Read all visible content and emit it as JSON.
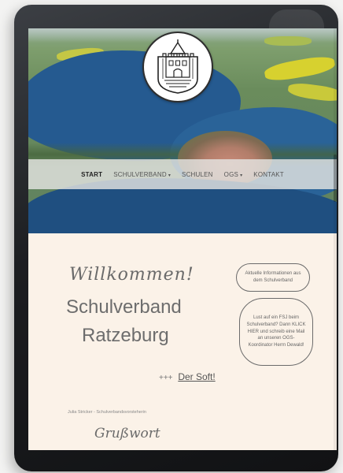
{
  "nav": {
    "items": [
      {
        "label": "START",
        "active": true,
        "dropdown": false
      },
      {
        "label": "SCHULVERBAND",
        "active": false,
        "dropdown": true
      },
      {
        "label": "SCHULEN",
        "active": false,
        "dropdown": false
      },
      {
        "label": "OGS",
        "active": false,
        "dropdown": true
      },
      {
        "label": "KONTAKT",
        "active": false,
        "dropdown": false
      }
    ],
    "caret": "▾"
  },
  "hero": {
    "crest_icon": "castle-crest-icon"
  },
  "main": {
    "welcome": "Willkommen!",
    "title_line1": "Schulverband",
    "title_line2": "Ratzeburg",
    "news_prefix": "+++",
    "news_link": "Der Soft!",
    "author": "Julia Stricker - Schulverbandsvorsteherin",
    "greeting": "Grußwort"
  },
  "bubbles": {
    "info": "Aktuelle Informationen aus dem Schulverband",
    "fsj": "Lust auf ein FSJ beim Schulverband? Dann KLICK HIER und schreib eine Mail an unseren OGS-Koordinator Herrn Dewald!"
  },
  "colors": {
    "page_bg": "#fbf2e8",
    "lake": "#255a90",
    "text": "#6d6d6d"
  }
}
